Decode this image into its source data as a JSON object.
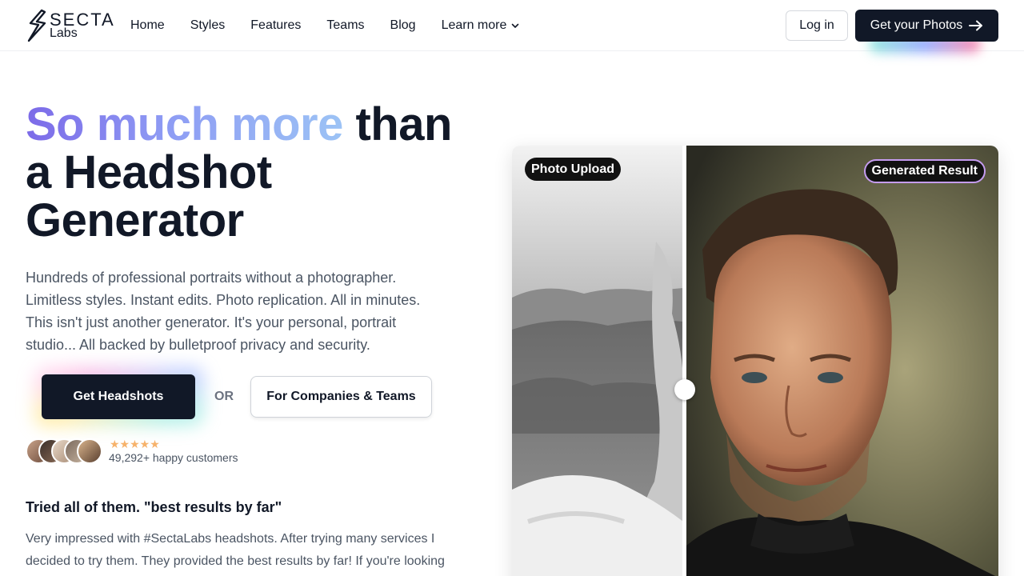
{
  "header": {
    "logo_top": "SECTA",
    "logo_bottom": "Labs",
    "nav": [
      {
        "label": "Home"
      },
      {
        "label": "Styles"
      },
      {
        "label": "Features"
      },
      {
        "label": "Teams"
      },
      {
        "label": "Blog"
      },
      {
        "label": "Learn more"
      }
    ],
    "login_label": "Log in",
    "cta_label": "Get your Photos"
  },
  "hero": {
    "title_gradient": "So much more",
    "title_rest": " than a Headshot Generator",
    "subtitle": "Hundreds of professional portraits without a photographer. Limitless styles. Instant edits. Photo replication. All in minutes. This isn't just another generator. It's your personal, portrait studio... All backed by bulletproof privacy and security.",
    "primary_cta": "Get Headshots",
    "or_label": "OR",
    "secondary_cta": "For Companies & Teams",
    "stars": "★★★★★",
    "customers": "49,292+ happy customers"
  },
  "review": {
    "title": "Tried all of them. \"best results by far\"",
    "body": "Very impressed with #SectaLabs headshots. After trying many services I decided to try them. They provided the best results by far! If you're looking"
  },
  "compare": {
    "left_label": "Photo Upload",
    "right_label": "Generated Result",
    "slider_position": 0.35
  },
  "colors": {
    "dark": "#111827",
    "gradient_start": "#7c6ae8",
    "gradient_end": "#9cc3f5",
    "star": "#f6b26b",
    "result_badge_border": "#c59cf0"
  }
}
